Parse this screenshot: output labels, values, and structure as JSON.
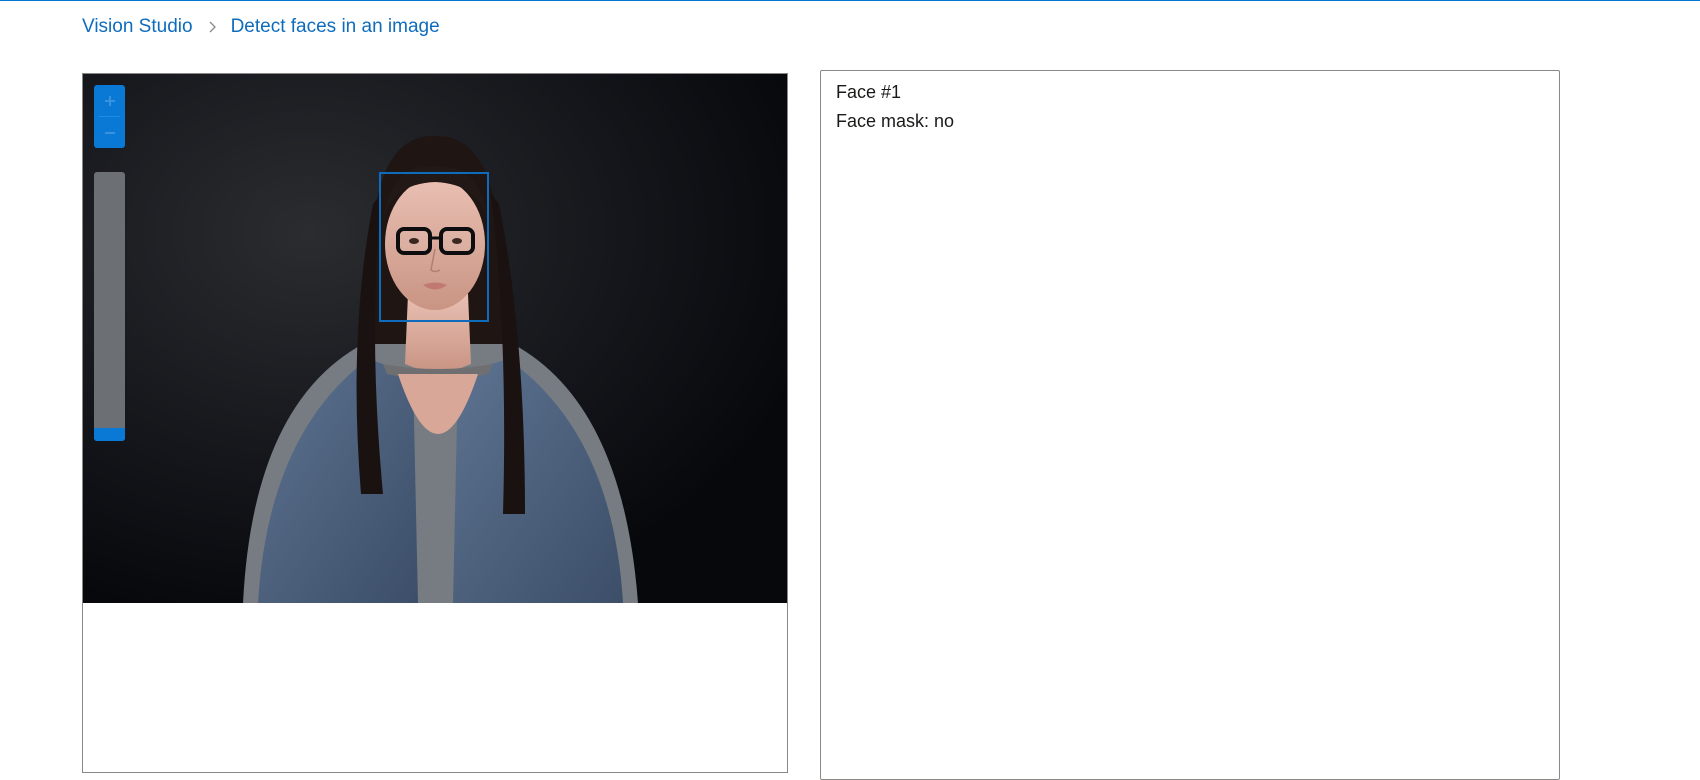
{
  "breadcrumb": {
    "home": "Vision Studio",
    "current": "Detect faces in an image",
    "separator_icon": "chevron-right-icon"
  },
  "viewer": {
    "zoom_in_icon": "plus-icon",
    "zoom_out_icon": "minus-icon",
    "zoom_level_fraction": 0.05,
    "detected_faces": 1
  },
  "results": {
    "face_title": "Face #1",
    "face_mask": "Face mask: no"
  },
  "colors": {
    "accent": "#0078d4",
    "link": "#0f6cbd",
    "face_box": "#0f6cbd",
    "slider_track": "#6c6f74"
  }
}
